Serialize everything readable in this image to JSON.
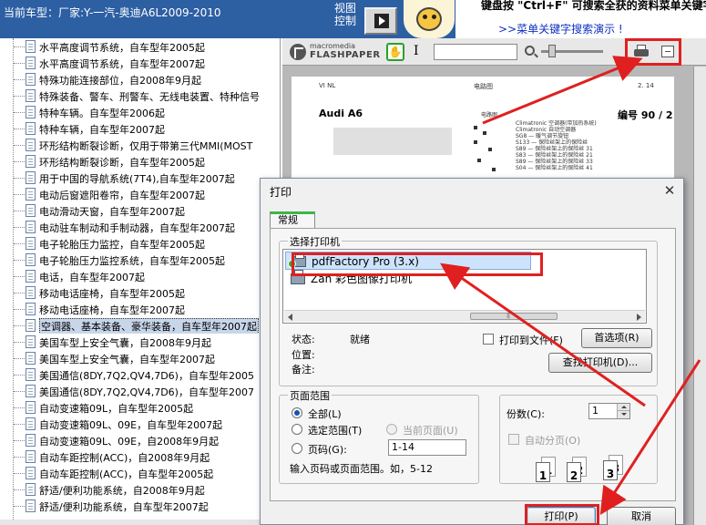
{
  "header": {
    "car_model": "当前车型：厂家:Y-一汽-奥迪A6L2009-2010",
    "view_control_line1": "视图",
    "view_control_line2": "控制",
    "banner_text": "键盘按 \"Ctrl+F\" 可搜索全获的资料菜单关键字!",
    "banner_link": ">>菜单关键字搜索演示 !"
  },
  "sidebar": {
    "items": [
      {
        "label": "水平高度调节系统，自车型年2005起"
      },
      {
        "label": "水平高度调节系统，自车型年2007起"
      },
      {
        "label": "特殊功能连接部位，自2008年9月起"
      },
      {
        "label": "特殊装备、警车、刑警车、无线电装置、特种信号"
      },
      {
        "label": "特种车辆。自车型年2006起"
      },
      {
        "label": "特种车辆，自车型年2007起"
      },
      {
        "label": "环形结构断裂诊断，仅用于带第三代MMI(MOST"
      },
      {
        "label": "环形结构断裂诊断，自车型年2005起"
      },
      {
        "label": "用于中国的导航系统(7T4),自车型年2007起"
      },
      {
        "label": "电动后窗遮阳卷帘，自车型年2007起"
      },
      {
        "label": "电动滑动天窗，自车型年2007起"
      },
      {
        "label": "电动驻车制动和手制动器，自车型年2007起"
      },
      {
        "label": "电子轮胎压力监控，自车型年2005起"
      },
      {
        "label": "电子轮胎压力监控系统，自车型年2005起"
      },
      {
        "label": "电话，自车型年2007起"
      },
      {
        "label": "移动电话座椅，自车型年2005起"
      },
      {
        "label": "移动电话座椅，自车型年2007起"
      },
      {
        "label": "空调器、基本装备、豪华装备，自车型年2007起"
      },
      {
        "label": "美国车型上安全气囊，自2008年9月起"
      },
      {
        "label": "美国车型上安全气囊，自车型年2007起"
      },
      {
        "label": "美国通信(8DY,7Q2,QV4,7D6)，自车型年2005"
      },
      {
        "label": "美国通信(8DY,7Q2,QV4,7D6)，自车型年2007"
      },
      {
        "label": "自动变速箱09L，自车型年2005起"
      },
      {
        "label": "自动变速箱09L、09E，自车型年2007起"
      },
      {
        "label": "自动变速箱09L、09E，自2008年9月起"
      },
      {
        "label": "自动车距控制(ACC)，自2008年9月起"
      },
      {
        "label": "自动车距控制(ACC)，自车型年2005起"
      },
      {
        "label": "舒适/便利功能系统，自2008年9月起"
      },
      {
        "label": "舒适/便利功能系统，自车型年2007起"
      }
    ],
    "selected_index": 17
  },
  "viewer": {
    "brand_line1": "macromedia",
    "brand_line2": "FLASHPAPER",
    "text_tool_glyph": "I",
    "page": {
      "header_left": "VI NL",
      "header_mid": "电路图",
      "header_right": "2. 14",
      "car": "Audi A6",
      "code_label": "编号  90 / 2",
      "title_small": "电路图",
      "code_lines": [
        "Climatronic 空调器(带加热系统)",
        "Climatronic 自动空调器",
        "SG8 —  暖气调节旋钮",
        "S133 —  保险丝架上的保险丝",
        "S89  —  保险丝架上的保险丝 31",
        "S83  —  保险丝架上的保险丝 21",
        "S89  —  保险丝架上的保险丝 33",
        "S04  —  保险丝架上的保险丝 41"
      ],
      "glyph_row": "⊥ ⊥ ⊥   ⊥⊥⊥   ⊥⊥⊥   ⊥"
    }
  },
  "dialog": {
    "title": "打印",
    "close_glyph": "✕",
    "tab_label": "常规",
    "select_printer_label": "选择打印机",
    "printers": [
      {
        "name": "pdfFactory Pro (3.x)"
      },
      {
        "name": "Zan 彩色图像打印机"
      }
    ],
    "scroll_grip": "|||",
    "status_label": "状态:",
    "status_value": "就绪",
    "location_label": "位置:",
    "comment_label": "备注:",
    "print_to_file_label": "打印到文件(F)",
    "preferences_button": "首选项(R)",
    "find_printer_button": "查找打印机(D)...",
    "page_range_label": "页面范围",
    "range_all": "全部(L)",
    "range_selection": "选定范围(T)",
    "range_current": "当前页面(U)",
    "range_pages": "页码(G):",
    "pages_value": "1-14",
    "pages_hint": "输入页码或页面范围。如，5-12",
    "copies_label": "份数(C):",
    "copies_value": "1",
    "collate_label": "自动分页(O)",
    "collate_pages": [
      "1",
      "1",
      "2",
      "2",
      "3",
      "3"
    ],
    "print_button": "打印(P)",
    "cancel_button": "取消"
  }
}
